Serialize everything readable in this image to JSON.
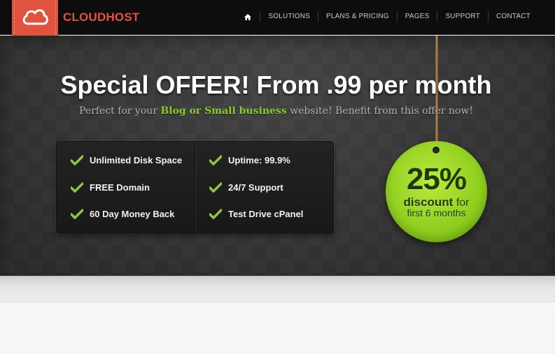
{
  "header": {
    "brand": "CLOUDHOST",
    "nav": [
      {
        "label": "SOLUTIONS"
      },
      {
        "label": "PLANS & PRICING"
      },
      {
        "label": "PAGES"
      },
      {
        "label": "SUPPORT"
      },
      {
        "label": "CONTACT"
      }
    ]
  },
  "hero": {
    "headline": "Special OFFER! From .99 per month",
    "sub_prefix": "Perfect for your ",
    "sub_accent": "Blog or Small business",
    "sub_suffix": " website! Benefit from this offer now!",
    "features_left": [
      "Unlimited Disk Space",
      "FREE Domain",
      "60 Day Money Back"
    ],
    "features_right": [
      "Uptime: 99.9%",
      "24/7 Support",
      "Test Drive cPanel"
    ],
    "tag": {
      "percent": "25%",
      "discount": "discount",
      "for": "for",
      "period": "first 6 months"
    }
  },
  "colors": {
    "brand": "#e2533f",
    "accent_green": "#8fcb2c",
    "check_green": "#8dc63f"
  }
}
